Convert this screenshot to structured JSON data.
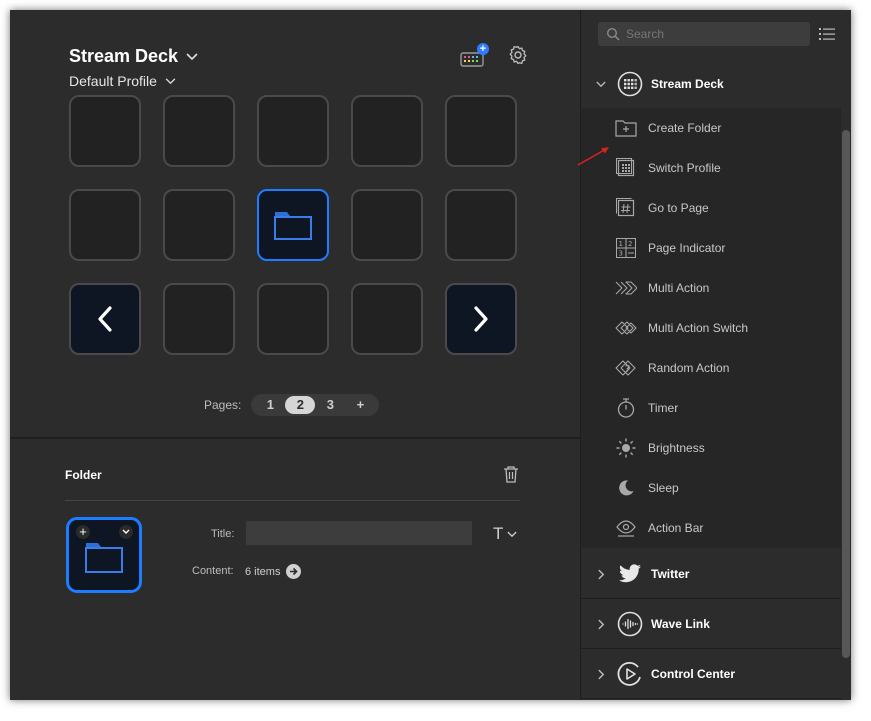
{
  "header": {
    "device": "Stream Deck",
    "profile": "Default Profile"
  },
  "pages": {
    "label": "Pages:",
    "items": [
      "1",
      "2",
      "3"
    ],
    "active": "2",
    "add": "+"
  },
  "folder": {
    "section_title": "Folder",
    "title_label": "Title:",
    "title_value": "",
    "content_label": "Content:",
    "content_value": "6 items",
    "text_tool": "T"
  },
  "sidebar": {
    "search_placeholder": "Search",
    "categories": [
      {
        "name": "Stream Deck",
        "expanded": true
      },
      {
        "name": "Twitter",
        "expanded": false
      },
      {
        "name": "Wave Link",
        "expanded": false
      },
      {
        "name": "Control Center",
        "expanded": false
      }
    ],
    "actions": [
      {
        "label": "Create Folder",
        "icon": "create-folder-icon"
      },
      {
        "label": "Switch Profile",
        "icon": "switch-profile-icon"
      },
      {
        "label": "Go to Page",
        "icon": "go-to-page-icon"
      },
      {
        "label": "Page Indicator",
        "icon": "page-indicator-icon"
      },
      {
        "label": "Multi Action",
        "icon": "multi-action-icon"
      },
      {
        "label": "Multi Action Switch",
        "icon": "multi-action-switch-icon"
      },
      {
        "label": "Random Action",
        "icon": "random-action-icon"
      },
      {
        "label": "Timer",
        "icon": "timer-icon"
      },
      {
        "label": "Brightness",
        "icon": "brightness-icon"
      },
      {
        "label": "Sleep",
        "icon": "sleep-icon"
      },
      {
        "label": "Action Bar",
        "icon": "action-bar-icon"
      }
    ]
  },
  "colors": {
    "accent": "#1e7cff",
    "background": "#2c2c2c",
    "key_background": "#222222",
    "annotation_arrow": "#e0201c"
  }
}
